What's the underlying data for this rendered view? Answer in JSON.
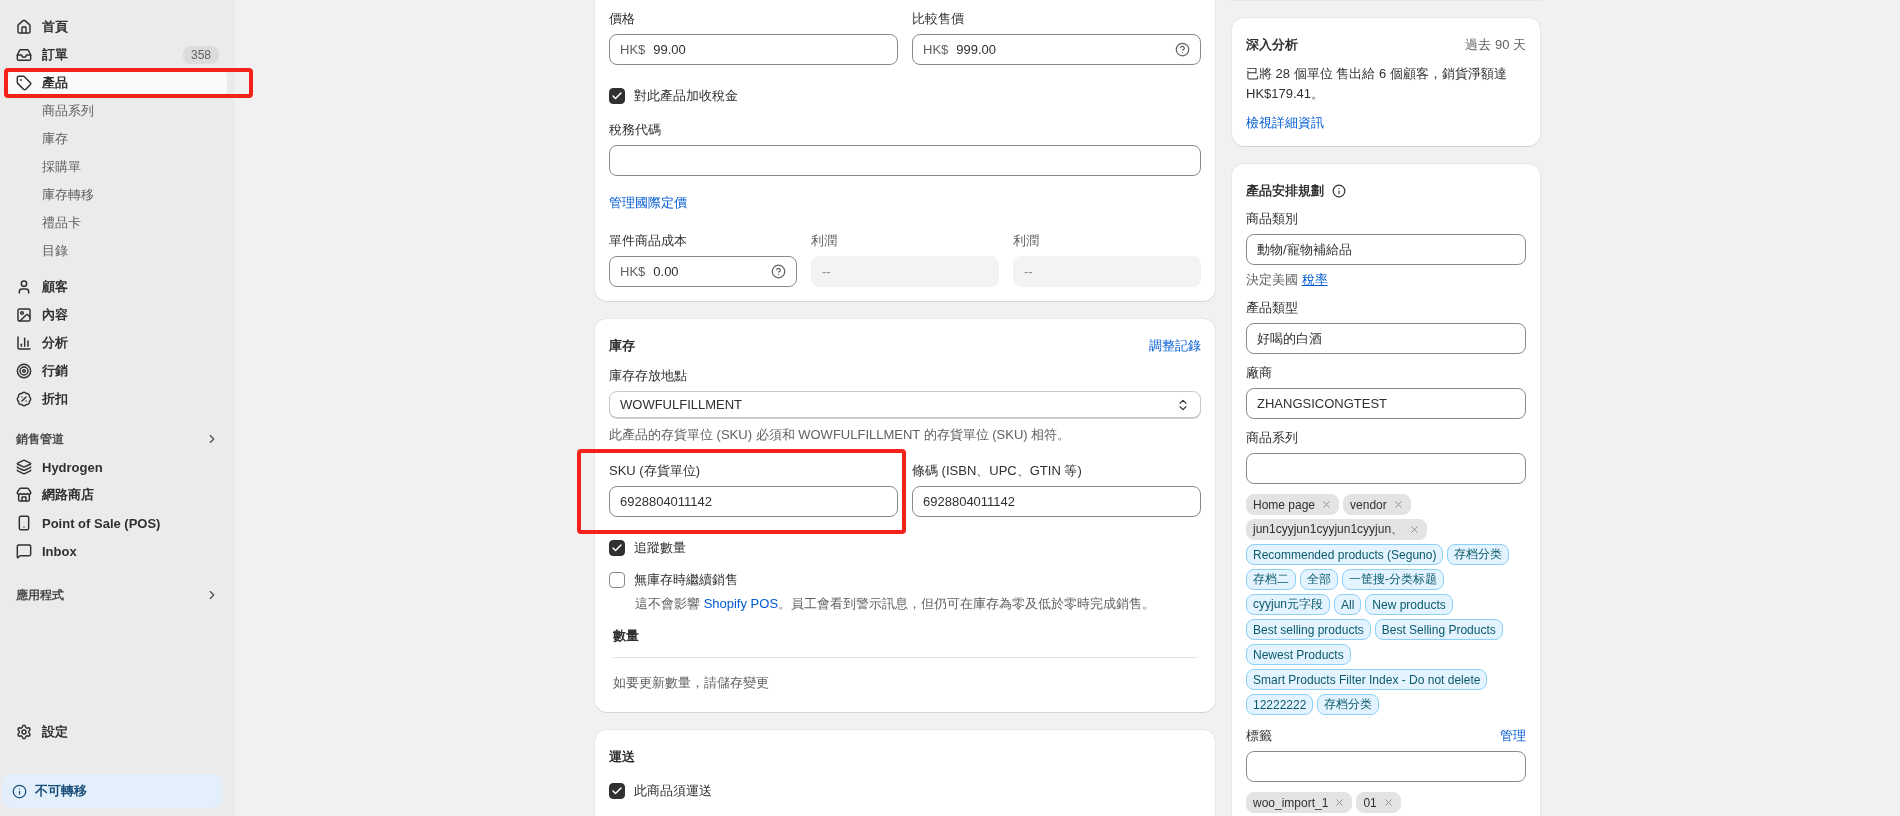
{
  "sidebar": {
    "main_items": [
      {
        "label": "首頁",
        "selected": false,
        "highlighted": false
      },
      {
        "label": "訂單",
        "selected": false,
        "highlighted": false,
        "badge": "358"
      },
      {
        "label": "產品",
        "selected": true,
        "highlighted": true,
        "children": [
          {
            "label": "商品系列"
          },
          {
            "label": "庫存"
          },
          {
            "label": "採購單"
          },
          {
            "label": "庫存轉移"
          },
          {
            "label": "禮品卡"
          },
          {
            "label": "目錄"
          }
        ]
      },
      {
        "label": "顧客",
        "selected": false,
        "highlighted": false
      },
      {
        "label": "內容",
        "selected": false,
        "highlighted": false
      },
      {
        "label": "分析",
        "selected": false,
        "highlighted": false
      },
      {
        "label": "行銷",
        "selected": false,
        "highlighted": false
      },
      {
        "label": "折扣",
        "selected": false,
        "highlighted": false
      }
    ],
    "sales_channels": {
      "title": "銷售管道",
      "items": [
        "Hydrogen",
        "網路商店",
        "Point of Sale (POS)",
        "Inbox"
      ]
    },
    "apps": {
      "title": "應用程式"
    },
    "settings": "設定",
    "notice": "不可轉移"
  },
  "pricing": {
    "fields": [
      {
        "label": "價格",
        "prefix": "HK$",
        "value": "99.00",
        "help": false
      },
      {
        "label": "比較售價",
        "prefix": "HK$",
        "value": "999.00",
        "help": true
      }
    ],
    "charge_tax": {
      "label": "對此產品加收稅金",
      "checked": true
    },
    "tax_code": {
      "label": "稅務代碼"
    },
    "link": "管理國際定價",
    "cost_row": [
      {
        "kind": "input",
        "label": "單件商品成本",
        "prefix": "HK$",
        "value": "0.00",
        "help": true
      },
      {
        "kind": "readonly",
        "label": "利潤",
        "value": "--"
      },
      {
        "kind": "readonly",
        "label": "利潤",
        "value": "--"
      }
    ]
  },
  "inventory": {
    "title": "庫存",
    "action": "調整記錄",
    "location_label": "庫存存放地點",
    "location_value": "WOWFULFILLMENT",
    "location_help": "此產品的存貨單位 (SKU) 必須和 WOWFULFILLMENT 的存貨單位 (SKU) 相符。",
    "sku": {
      "label": "SKU (存貨單位)",
      "value": "6928804011142",
      "highlighted": true
    },
    "barcode": {
      "label": "條碼 (ISBN、UPC、GTIN 等)",
      "value": "6928804011142"
    },
    "track": {
      "label": "追蹤數量",
      "checked": true
    },
    "continue_selling": {
      "label": "無庫存時繼續銷售",
      "checked": false,
      "help_before": "這不會影響",
      "help_link": "Shopify POS",
      "help_after": "。員工會看到警示訊息，但仍可在庫存為零及低於零時完成銷售。"
    },
    "quantity_title": "數量",
    "quantity_note": "如要更新數量，請儲存變更"
  },
  "shipping": {
    "title": "運送",
    "requires_shipping": {
      "label": "此商品須運送",
      "checked": true
    }
  },
  "analytics": {
    "title": "深入分析",
    "period": "過去 90 天",
    "text": "已將 28 個單位 售出給 6 個顧客，銷貨淨額達 HK$179.41。",
    "link": "檢視詳細資訊"
  },
  "organization": {
    "title": "產品安排規劃",
    "category_label": "商品類別",
    "category_value": "動物/寵物補給品",
    "tax_note": "決定美國",
    "tax_link": "稅率",
    "type_label": "產品類型",
    "type_value": "好喝的白酒",
    "vendor_label": "廠商",
    "vendor_value": "ZHANGSICONGTEST",
    "collections_label": "商品系列",
    "collection_tags": [
      {
        "label": "Home page",
        "kind": "manual"
      },
      {
        "label": "vendor",
        "kind": "manual"
      },
      {
        "label": "jun1cyyjun1cyyjun1cyyjun、",
        "kind": "manual"
      },
      {
        "label": "Recommended products (Seguno)",
        "kind": "smart"
      },
      {
        "label": "存档分类",
        "kind": "smart"
      },
      {
        "label": "存档二",
        "kind": "smart"
      },
      {
        "label": "全部",
        "kind": "smart"
      },
      {
        "label": "一筐搜-分类标题",
        "kind": "smart"
      },
      {
        "label": "cyyjun元字段",
        "kind": "smart"
      },
      {
        "label": "All",
        "kind": "smart"
      },
      {
        "label": "New products",
        "kind": "smart"
      },
      {
        "label": "Best selling products",
        "kind": "smart"
      },
      {
        "label": "Best Selling Products",
        "kind": "smart"
      },
      {
        "label": "Newest Products",
        "kind": "smart"
      },
      {
        "label": "Smart Products Filter Index - Do not delete",
        "kind": "smart"
      },
      {
        "label": "12222222",
        "kind": "smart"
      },
      {
        "label": "存档分类",
        "kind": "smart"
      }
    ],
    "tags_label": "標籤",
    "tags_manage": "管理",
    "tags": [
      {
        "label": "woo_import_1",
        "kind": "manual"
      },
      {
        "label": "01",
        "kind": "manual"
      }
    ]
  }
}
